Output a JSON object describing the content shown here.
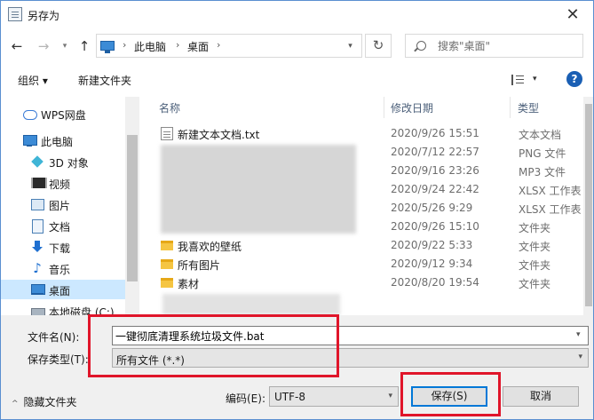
{
  "window": {
    "title": "另存为",
    "close_glyph": "✕"
  },
  "nav": {
    "back_glyph": "←",
    "forward_glyph": "→",
    "up_glyph": "↑",
    "refresh_glyph": "↻",
    "breadcrumb": [
      "此电脑",
      "桌面"
    ],
    "search_placeholder": "搜索\"桌面\""
  },
  "toolbar": {
    "organize_label": "组织 ▾",
    "new_folder_label": "新建文件夹"
  },
  "sidebar": {
    "items": [
      {
        "label": "WPS网盘",
        "icon": "cloud-icon"
      },
      {
        "label": "此电脑",
        "icon": "computer-icon"
      },
      {
        "label": "3D 对象",
        "icon": "cube-icon"
      },
      {
        "label": "视频",
        "icon": "video-icon"
      },
      {
        "label": "图片",
        "icon": "image-icon"
      },
      {
        "label": "文档",
        "icon": "document-icon"
      },
      {
        "label": "下载",
        "icon": "download-icon"
      },
      {
        "label": "音乐",
        "icon": "music-icon"
      },
      {
        "label": "桌面",
        "icon": "desktop-icon",
        "selected": true
      },
      {
        "label": "本地磁盘 (C:)",
        "icon": "drive-icon"
      }
    ]
  },
  "file_list": {
    "columns": {
      "name": "名称",
      "date": "修改日期",
      "type": "类型"
    },
    "rows": [
      {
        "name": "新建文本文档.txt",
        "date": "2020/9/26 15:51",
        "type": "文本文档",
        "icon": "text-file-icon"
      },
      {
        "name": "",
        "date": "2020/7/12 22:57",
        "type": "PNG 文件",
        "icon": ""
      },
      {
        "name": "",
        "date": "2020/9/16 23:26",
        "type": "MP3 文件",
        "icon": ""
      },
      {
        "name": "",
        "date": "2020/9/24 22:42",
        "type": "XLSX 工作表",
        "icon": ""
      },
      {
        "name": "",
        "date": "2020/5/26 9:29",
        "type": "XLSX 工作表",
        "icon": ""
      },
      {
        "name": "",
        "date": "2020/9/26 15:10",
        "type": "文件夹",
        "icon": "folder-icon"
      },
      {
        "name": "我喜欢的壁纸",
        "date": "2020/9/22 5:33",
        "type": "文件夹",
        "icon": "folder-icon"
      },
      {
        "name": "所有图片",
        "date": "2020/9/12 9:34",
        "type": "文件夹",
        "icon": "folder-icon"
      },
      {
        "name": "素材",
        "date": "2020/8/20 19:54",
        "type": "文件夹",
        "icon": "folder-icon"
      }
    ]
  },
  "form": {
    "filename_label": "文件名(N):",
    "filename_value": "一键彻底清理系统垃圾文件.bat",
    "filetype_label": "保存类型(T):",
    "filetype_value": "所有文件 (*.*)",
    "hide_folders_label": "隐藏文件夹",
    "encoding_label": "编码(E):",
    "encoding_value": "UTF-8",
    "save_label": "保存(S)",
    "cancel_label": "取消"
  },
  "colors": {
    "highlight": "#e0152a",
    "selection": "#cce8ff",
    "accent": "#0078d7"
  }
}
